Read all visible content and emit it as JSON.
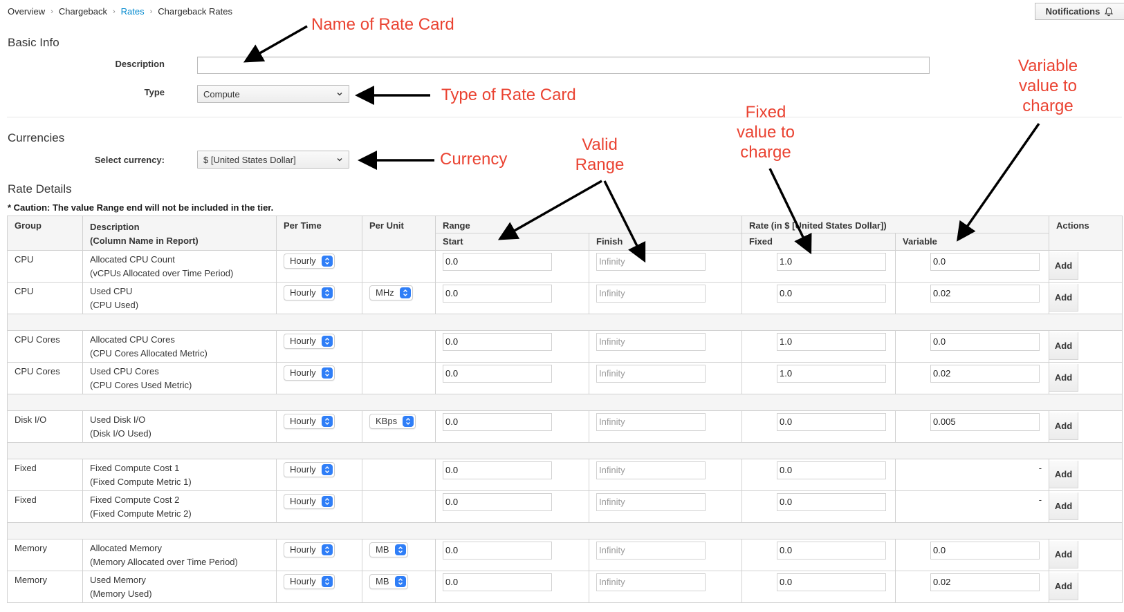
{
  "breadcrumb": [
    "Overview",
    "Chargeback",
    "Rates",
    "Chargeback Rates"
  ],
  "notifications_label": "Notifications",
  "basic_info": {
    "title": "Basic Info",
    "description_label": "Description",
    "description_value": "",
    "type_label": "Type",
    "type_value": "Compute"
  },
  "currencies": {
    "title": "Currencies",
    "select_label": "Select currency:",
    "select_value": "$ [United States Dollar]"
  },
  "rate_details": {
    "title": "Rate Details",
    "caution": "* Caution: The value Range end will not be included in the tier.",
    "headers": {
      "group": "Group",
      "description": "Description",
      "description_sub": "(Column Name in Report)",
      "per_time": "Per Time",
      "per_unit": "Per Unit",
      "range": "Range",
      "start": "Start",
      "finish": "Finish",
      "rate": "Rate (in $ [United States Dollar])",
      "fixed": "Fixed",
      "variable": "Variable",
      "actions": "Actions"
    },
    "rows": [
      {
        "group": "CPU",
        "desc": "Allocated CPU Count",
        "sub": "(vCPUs Allocated over Time Period)",
        "per_time": "Hourly",
        "per_unit": "",
        "start": "0.0",
        "finish": "Infinity",
        "fixed": "1.0",
        "variable": "0.0",
        "action": "Add"
      },
      {
        "group": "CPU",
        "desc": "Used CPU",
        "sub": "(CPU Used)",
        "per_time": "Hourly",
        "per_unit": "MHz",
        "start": "0.0",
        "finish": "Infinity",
        "fixed": "0.0",
        "variable": "0.02",
        "action": "Add"
      },
      {
        "spacer": true
      },
      {
        "group": "CPU Cores",
        "desc": "Allocated CPU Cores",
        "sub": "(CPU Cores Allocated Metric)",
        "per_time": "Hourly",
        "per_unit": "",
        "start": "0.0",
        "finish": "Infinity",
        "fixed": "1.0",
        "variable": "0.0",
        "action": "Add"
      },
      {
        "group": "CPU Cores",
        "desc": "Used CPU Cores",
        "sub": "(CPU Cores Used Metric)",
        "per_time": "Hourly",
        "per_unit": "",
        "start": "0.0",
        "finish": "Infinity",
        "fixed": "1.0",
        "variable": "0.02",
        "action": "Add"
      },
      {
        "spacer": true
      },
      {
        "group": "Disk I/O",
        "desc": "Used Disk I/O",
        "sub": "(Disk I/O Used)",
        "per_time": "Hourly",
        "per_unit": "KBps",
        "start": "0.0",
        "finish": "Infinity",
        "fixed": "0.0",
        "variable": "0.005",
        "action": "Add"
      },
      {
        "spacer": true
      },
      {
        "group": "Fixed",
        "desc": "Fixed Compute Cost 1",
        "sub": "(Fixed Compute Metric 1)",
        "per_time": "Hourly",
        "per_unit": "",
        "start": "0.0",
        "finish": "Infinity",
        "fixed": "0.0",
        "variable": "-",
        "action": "Add"
      },
      {
        "group": "Fixed",
        "desc": "Fixed Compute Cost 2",
        "sub": "(Fixed Compute Metric 2)",
        "per_time": "Hourly",
        "per_unit": "",
        "start": "0.0",
        "finish": "Infinity",
        "fixed": "0.0",
        "variable": "-",
        "action": "Add"
      },
      {
        "spacer": true
      },
      {
        "group": "Memory",
        "desc": "Allocated Memory",
        "sub": "(Memory Allocated over Time Period)",
        "per_time": "Hourly",
        "per_unit": "MB",
        "start": "0.0",
        "finish": "Infinity",
        "fixed": "0.0",
        "variable": "0.0",
        "action": "Add"
      },
      {
        "group": "Memory",
        "desc": "Used Memory",
        "sub": "(Memory Used)",
        "per_time": "Hourly",
        "per_unit": "MB",
        "start": "0.0",
        "finish": "Infinity",
        "fixed": "0.0",
        "variable": "0.02",
        "action": "Add"
      }
    ]
  },
  "annotations": {
    "name_of_rate_card": "Name of Rate Card",
    "type_of_rate_card": "Type of Rate Card",
    "currency": "Currency",
    "valid_range": [
      "Valid",
      "Range"
    ],
    "fixed_value": [
      "Fixed",
      "value to",
      "charge"
    ],
    "variable_value": [
      "Variable",
      "value to",
      "charge"
    ]
  },
  "colors": {
    "annotation": "#ea4332",
    "link": "#0088ce",
    "stepper": "#2f7ef7"
  }
}
